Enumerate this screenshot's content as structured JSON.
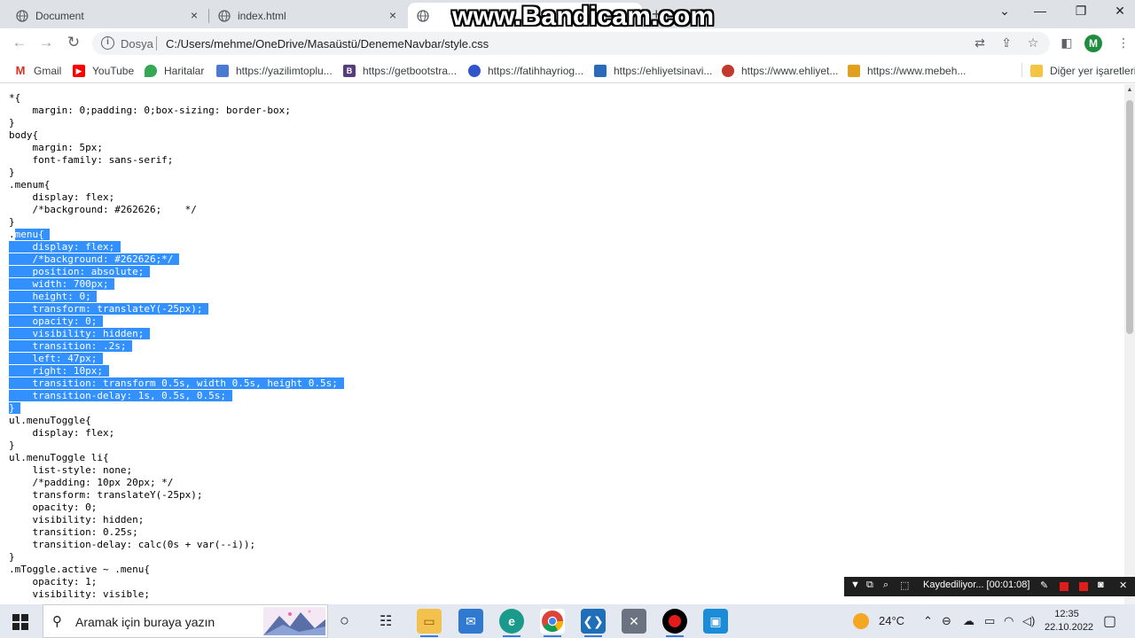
{
  "browser": {
    "tabs": [
      {
        "title": "Document"
      },
      {
        "title": "index.html"
      },
      {
        "title": ""
      }
    ],
    "new_tab": "+",
    "window_controls": {
      "dropdown": "⌄",
      "minimize": "—",
      "restore": "❐",
      "close": "✕"
    },
    "omnibox": {
      "security_label": "Dosya",
      "url": "C:/Users/mehme/OneDrive/Masaüstü/DenemeNavbar/style.css"
    },
    "profile_initial": "M",
    "bookmarks": [
      {
        "label": "Gmail",
        "icon": "gmail-icon",
        "color": "#d93025"
      },
      {
        "label": "YouTube",
        "icon": "youtube-icon",
        "color": "#ff0000"
      },
      {
        "label": "Haritalar",
        "icon": "maps-icon",
        "color": "#34a853"
      },
      {
        "label": "https://yazilimtoplu...",
        "icon": "site-icon",
        "color": "#4a7bd0"
      },
      {
        "label": "https://getbootstra...",
        "icon": "bootstrap-icon",
        "color": "#563d7c"
      },
      {
        "label": "https://fatihhayriog...",
        "icon": "site-icon",
        "color": "#3355cc"
      },
      {
        "label": "https://ehliyetsinavi...",
        "icon": "site-icon",
        "color": "#2a6ab8"
      },
      {
        "label": "https://www.ehliyet...",
        "icon": "site-icon",
        "color": "#c0392b"
      },
      {
        "label": "https://www.mebeh...",
        "icon": "folder-site-icon",
        "color": "#e0a020"
      }
    ],
    "other_bookmarks": "Diğer yer işaretleri"
  },
  "watermark": "www.Bandicam.com",
  "code_lines": [
    {
      "text": "*{",
      "selected": false
    },
    {
      "text": "    margin: 0;padding: 0;box-sizing: border-box;",
      "selected": false
    },
    {
      "text": "}",
      "selected": false
    },
    {
      "text": "body{",
      "selected": false
    },
    {
      "text": "    margin: 5px;",
      "selected": false
    },
    {
      "text": "    font-family: sans-serif;",
      "selected": false
    },
    {
      "text": "}",
      "selected": false
    },
    {
      "text": ".menum{",
      "selected": false
    },
    {
      "text": "    display: flex;",
      "selected": false
    },
    {
      "text": "    /*background: #262626;    */",
      "selected": false
    },
    {
      "text": "}",
      "selected": false
    },
    {
      "text": ".menu{",
      "selected": true,
      "sel_from": 1
    },
    {
      "text": "    display: flex;",
      "selected": true
    },
    {
      "text": "    /*background: #262626;*/",
      "selected": true
    },
    {
      "text": "    position: absolute;",
      "selected": true
    },
    {
      "text": "    width: 700px;",
      "selected": true
    },
    {
      "text": "    height: 0;",
      "selected": true
    },
    {
      "text": "    transform: translateY(-25px);",
      "selected": true
    },
    {
      "text": "    opacity: 0;",
      "selected": true
    },
    {
      "text": "    visibility: hidden;",
      "selected": true
    },
    {
      "text": "    transition: .2s;",
      "selected": true
    },
    {
      "text": "    left: 47px;",
      "selected": true
    },
    {
      "text": "    right: 10px;",
      "selected": true
    },
    {
      "text": "    transition: transform 0.5s, width 0.5s, height 0.5s;",
      "selected": true
    },
    {
      "text": "    transition-delay: 1s, 0.5s, 0.5s;",
      "selected": true
    },
    {
      "text": "}",
      "selected": true
    },
    {
      "text": "ul.menuToggle{",
      "selected": false
    },
    {
      "text": "    display: flex;",
      "selected": false
    },
    {
      "text": "}",
      "selected": false
    },
    {
      "text": "ul.menuToggle li{",
      "selected": false
    },
    {
      "text": "    list-style: none;",
      "selected": false
    },
    {
      "text": "    /*padding: 10px 20px; */",
      "selected": false
    },
    {
      "text": "    transform: translateY(-25px);",
      "selected": false
    },
    {
      "text": "    opacity: 0;",
      "selected": false
    },
    {
      "text": "    visibility: hidden;",
      "selected": false
    },
    {
      "text": "    transition: 0.25s;",
      "selected": false
    },
    {
      "text": "    transition-delay: calc(0s + var(--i));",
      "selected": false
    },
    {
      "text": "}",
      "selected": false
    },
    {
      "text": ".mToggle.active ~ .menu{",
      "selected": false
    },
    {
      "text": "    opacity: 1;",
      "selected": false
    },
    {
      "text": "    visibility: visible;",
      "selected": false
    }
  ],
  "recorder": {
    "status": "Kaydediliyor... [00:01:08]"
  },
  "taskbar": {
    "search_placeholder": "Aramak için buraya yazın",
    "weather": "24°C",
    "time": "12:35",
    "date": "22.10.2022"
  }
}
